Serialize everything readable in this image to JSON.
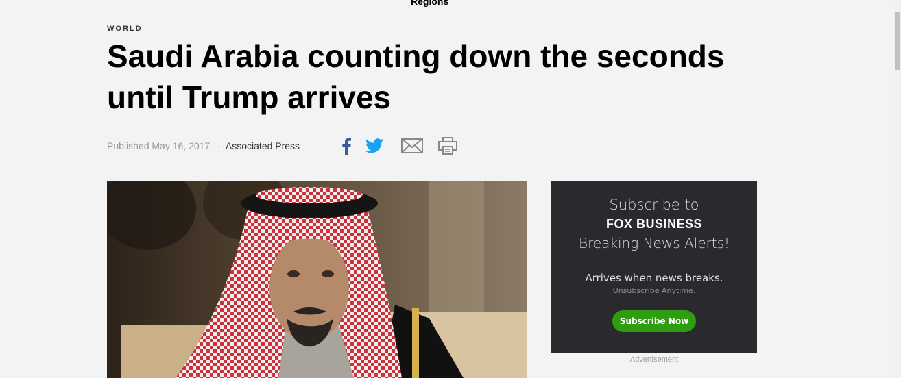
{
  "nav": {
    "partial_label": "Regions"
  },
  "article": {
    "category": "WORLD",
    "headline": "Saudi Arabia counting down the seconds until Trump arrives",
    "published": "Published May 16, 2017",
    "separator": "·",
    "author": "Associated Press",
    "hero_alt": "King Salman of Saudi Arabia wearing red-and-white ghutra"
  },
  "share": {
    "facebook_icon": "facebook-icon",
    "twitter_icon": "twitter-icon",
    "email_icon": "email-icon",
    "print_icon": "print-icon",
    "colors": {
      "facebook": "#3b5998",
      "twitter": "#1da1f2",
      "gray": "#888888"
    }
  },
  "ad": {
    "line1": "Subscribe to",
    "brand": "FOX BUSINESS",
    "line2": "Breaking News Alerts!",
    "line3": "Arrives when news breaks.",
    "line4": "Unsubscribe Anytime.",
    "cta": "Subscribe Now",
    "label": "Advertisement",
    "colors": {
      "background": "#2a292e",
      "cta": "#2f9c12"
    }
  }
}
